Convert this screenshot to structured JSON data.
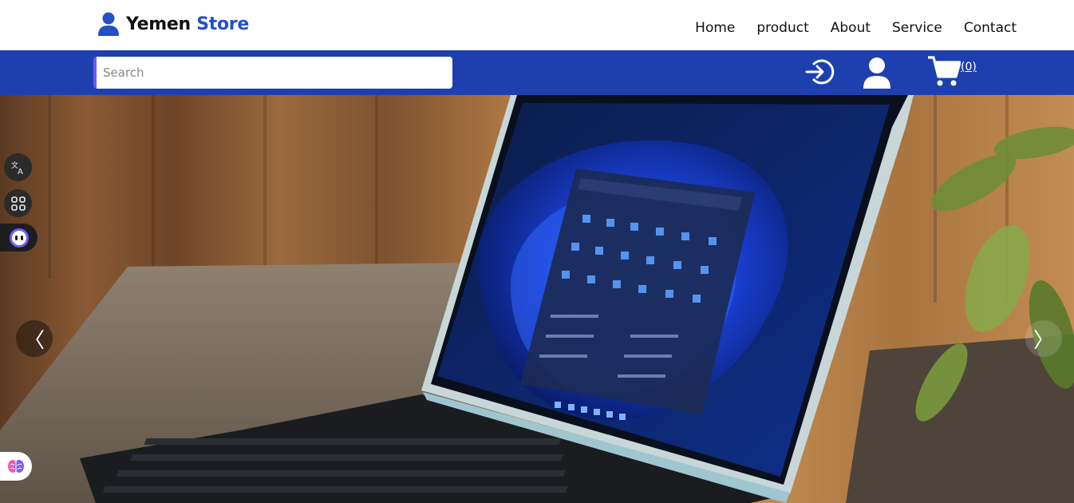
{
  "brand": {
    "name_part1": "Yemen",
    "name_part2": "Store",
    "icon": "user-icon"
  },
  "nav": {
    "items": [
      {
        "label": "Home"
      },
      {
        "label": "product"
      },
      {
        "label": "About"
      },
      {
        "label": "Service"
      },
      {
        "label": "Contact"
      }
    ]
  },
  "toolbar": {
    "search_placeholder": "Search",
    "search_value": "",
    "login_icon": "login-icon",
    "account_icon": "account-icon",
    "cart_icon": "cart-icon",
    "cart_count": "(0)"
  },
  "widgets": {
    "translate_icon": "translate-icon",
    "apps_icon": "apps-grid-icon",
    "bot_icon": "assistant-bot-icon",
    "brain_icon": "brain-icon"
  },
  "carousel": {
    "prev_label": "〈",
    "next_label": "〉",
    "slide_image": "laptop-windows-hero-image"
  },
  "colors": {
    "brand_accent": "#2450c6",
    "toolbar_bg": "#1e40af",
    "search_accent": "#6b5cf0"
  }
}
